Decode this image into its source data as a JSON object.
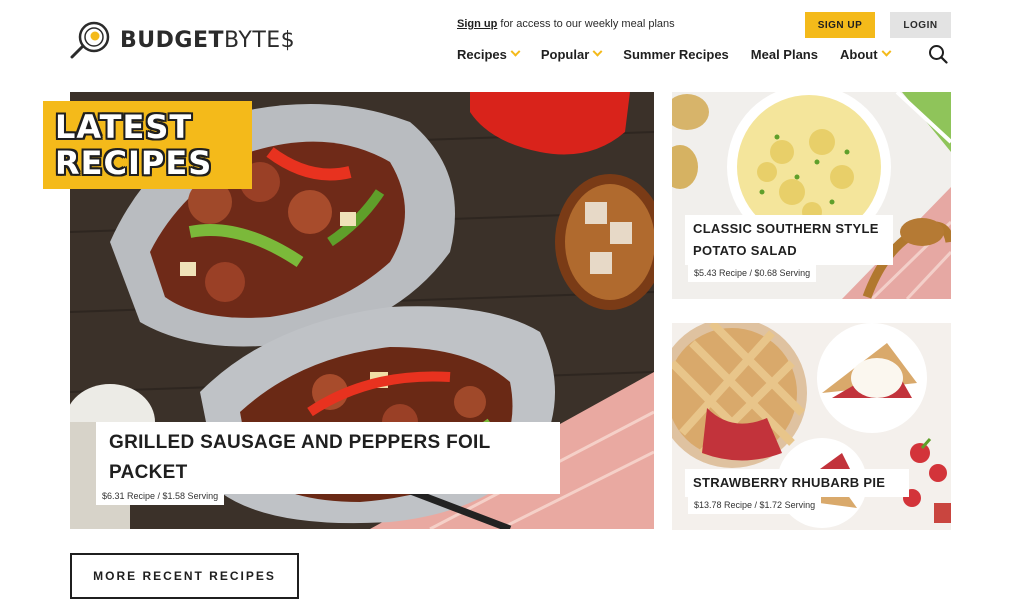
{
  "header": {
    "logo": {
      "brand_bold": "BUDGET",
      "brand_light": "BYTE$",
      "icon": "skillet-egg-icon"
    },
    "promo": {
      "link": "Sign up",
      "text": " for access to our weekly meal plans"
    },
    "signup_label": "SIGN UP",
    "login_label": "LOGIN",
    "nav": [
      {
        "label": "Recipes",
        "has_dropdown": true
      },
      {
        "label": "Popular",
        "has_dropdown": true
      },
      {
        "label": "Summer Recipes",
        "has_dropdown": false
      },
      {
        "label": "Meal Plans",
        "has_dropdown": false
      },
      {
        "label": "About",
        "has_dropdown": true
      }
    ],
    "search_icon": "search-icon"
  },
  "latest": {
    "line1": "LATEST",
    "line2": "RECIPES"
  },
  "featured": {
    "title": "GRILLED SAUSAGE AND PEPPERS FOIL PACKET",
    "price": "$6.31 Recipe / $1.58 Serving"
  },
  "side": [
    {
      "title": "CLASSIC SOUTHERN STYLE POTATO SALAD",
      "price": "$5.43 Recipe / $0.68 Serving"
    },
    {
      "title": "STRAWBERRY RHUBARB PIE",
      "price": "$13.78 Recipe / $1.72 Serving"
    }
  ],
  "more_label": "MORE RECENT RECIPES",
  "colors": {
    "accent": "#f4ba1a",
    "text": "#1f1f1f",
    "login_bg": "#e3e3e3"
  }
}
